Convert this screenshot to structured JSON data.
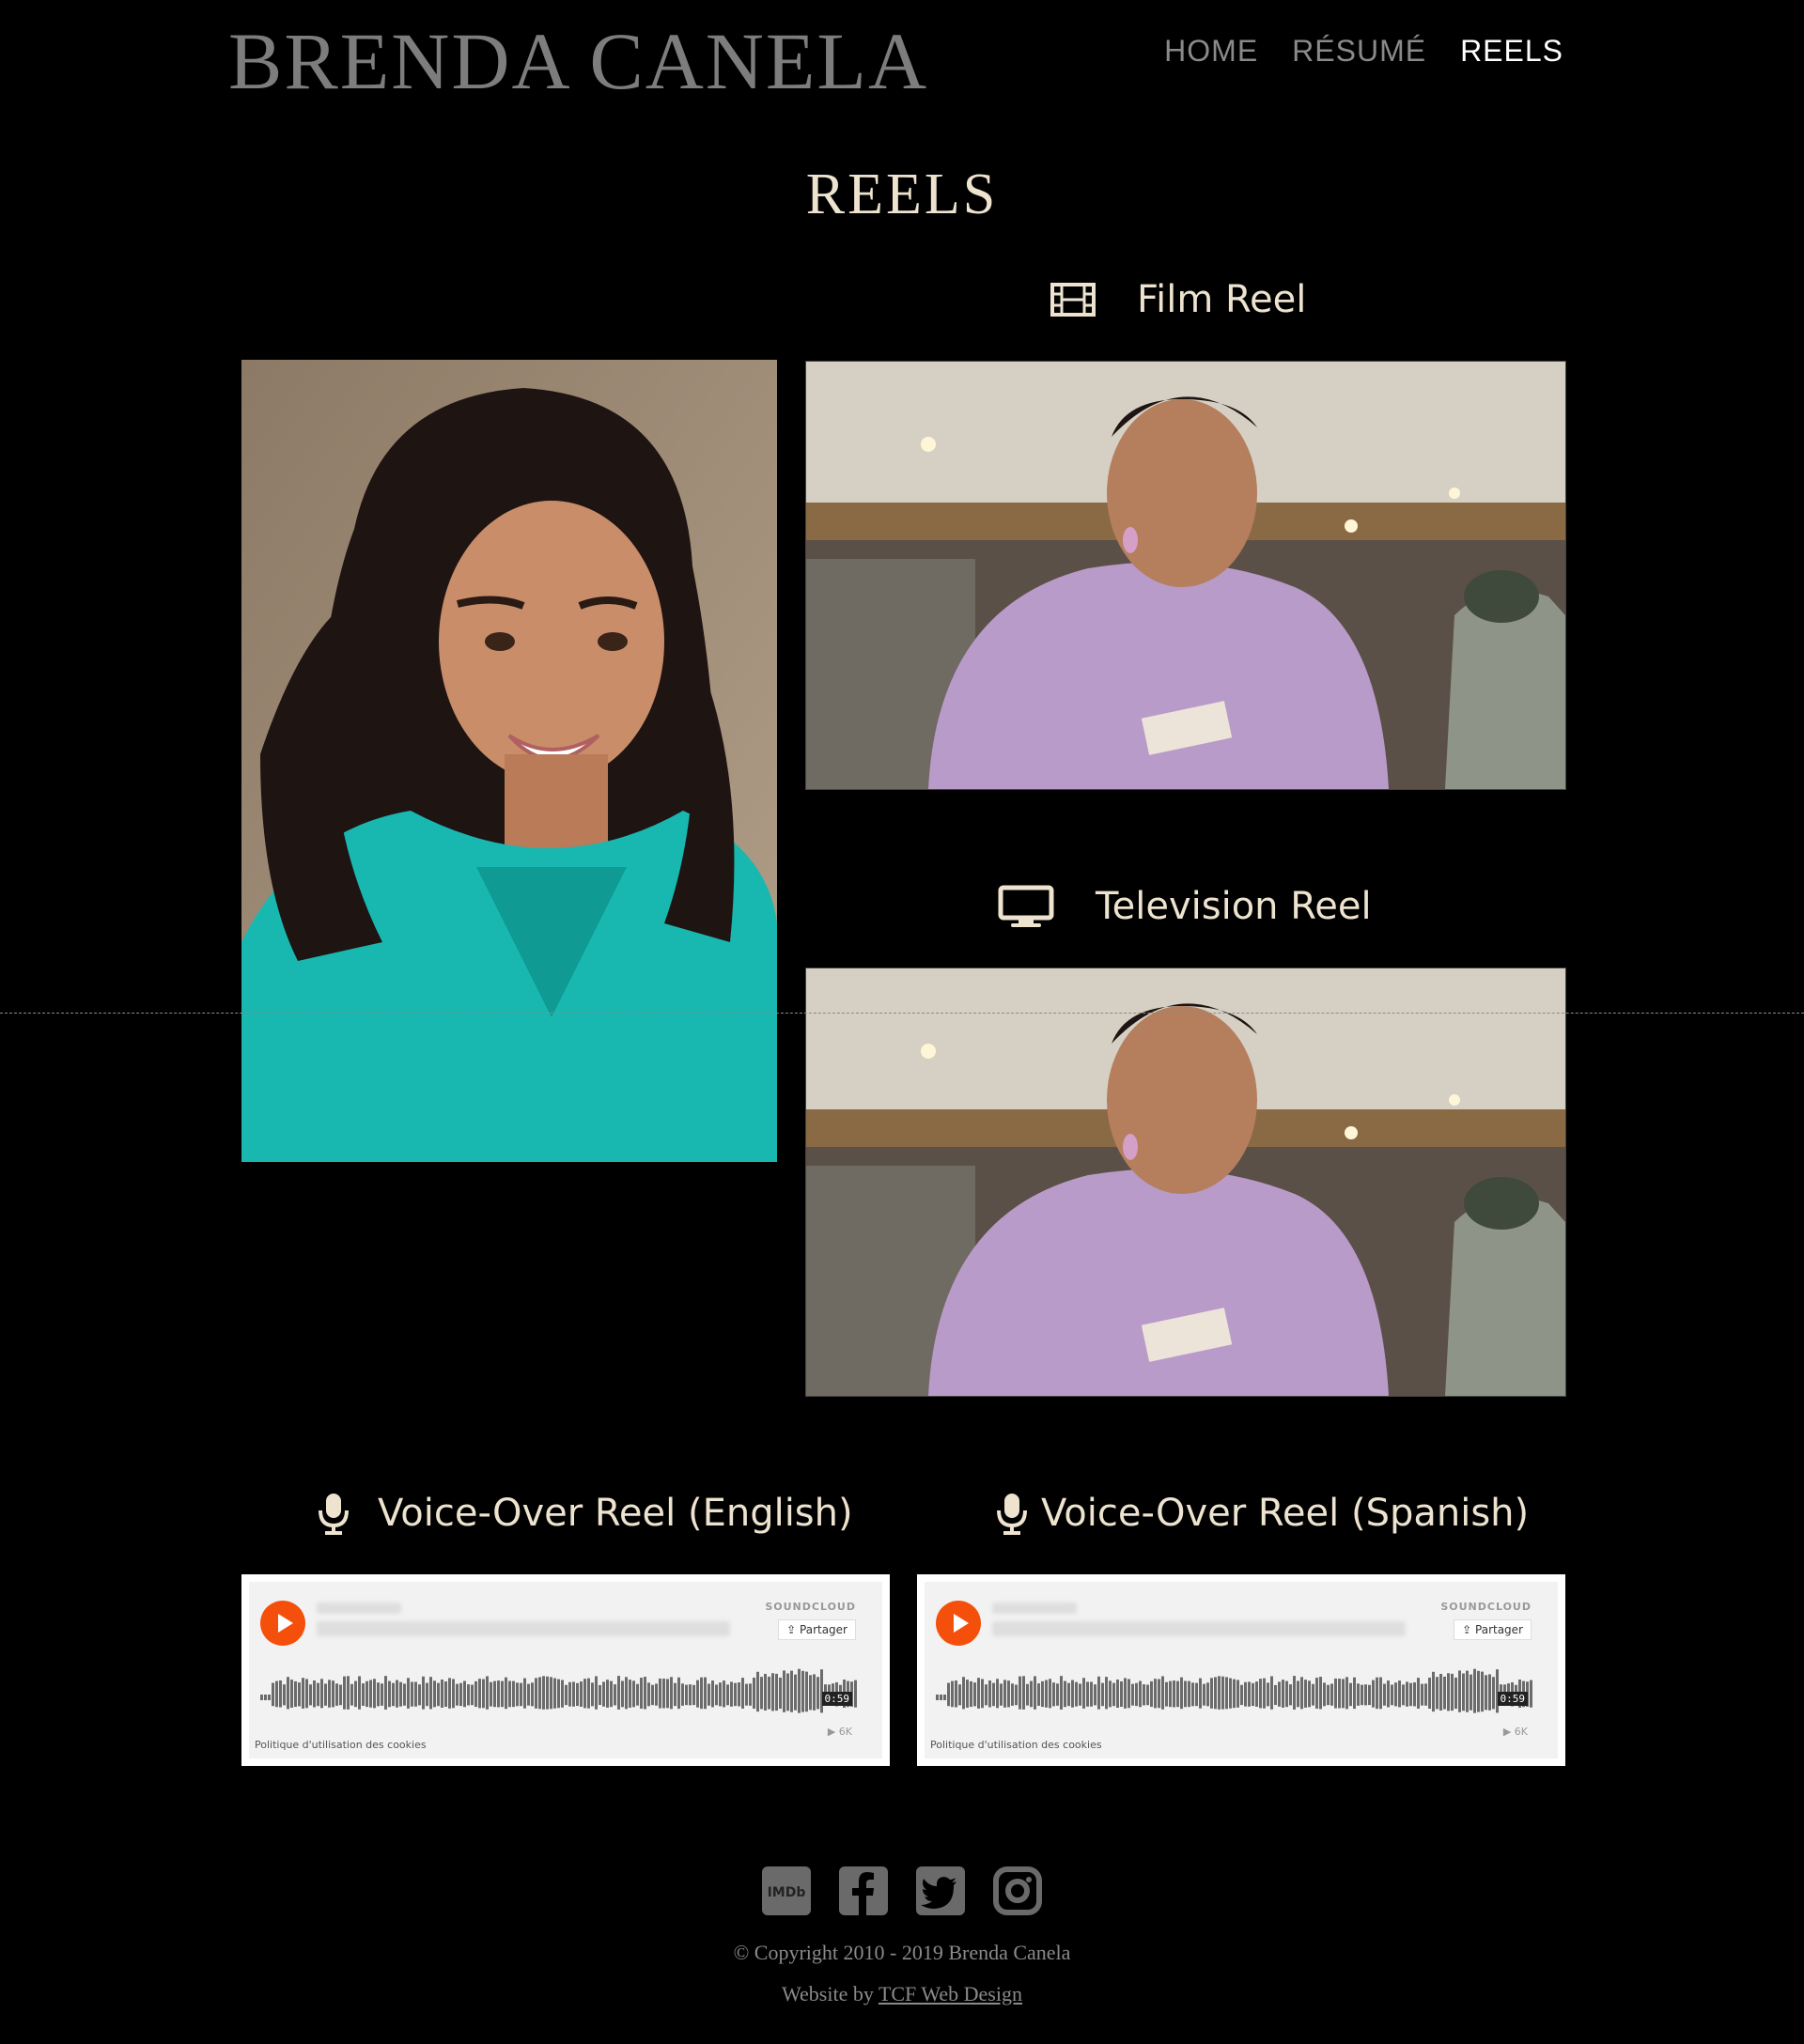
{
  "site": {
    "title": "BRENDA CANELA"
  },
  "nav": {
    "items": [
      {
        "label": "HOME"
      },
      {
        "label": "RÉSUMÉ"
      },
      {
        "label": "REELS"
      }
    ],
    "active": "REELS"
  },
  "page": {
    "heading": "REELS"
  },
  "reels": {
    "film": {
      "label": "Film Reel",
      "icon": "film-icon"
    },
    "television": {
      "label": "Television Reel",
      "icon": "tv-icon"
    },
    "vo_english": {
      "label": "Voice-Over Reel (English)",
      "icon": "microphone-icon"
    },
    "vo_spanish": {
      "label": "Voice-Over Reel (Spanish)",
      "icon": "microphone-icon"
    }
  },
  "soundcloud": {
    "brand": "SOUNDCLOUD",
    "share_label": "Partager",
    "duration": "0:59",
    "cookie_label": "Politique d'utilisation des cookies",
    "plays": "6K"
  },
  "footer": {
    "social": [
      "imdb-icon",
      "facebook-icon",
      "twitter-icon",
      "instagram-icon"
    ],
    "imdb_label": "IMDb",
    "copyright": "© Copyright 2010 - 2019 Brenda Canela",
    "credit_prefix": "Website by ",
    "credit_link": "TCF Web Design"
  },
  "colors": {
    "background": "#000000",
    "accent_text": "#ede3cf",
    "nav_inactive": "#8a8a8a",
    "soundcloud_orange": "#f5500b"
  }
}
